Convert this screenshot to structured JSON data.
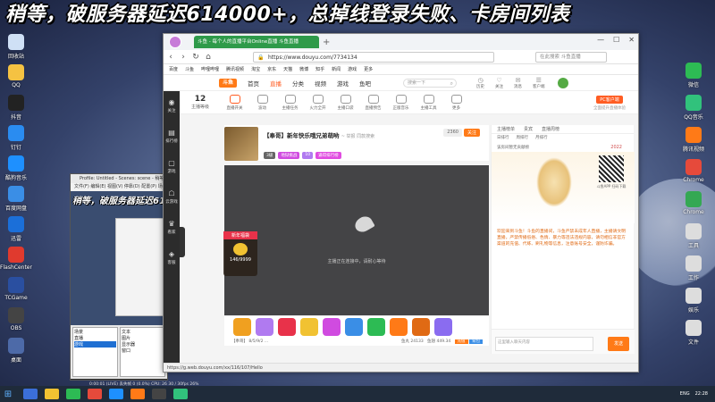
{
  "overlay": {
    "banner": "稍等，破服务器延迟614000+，总掉线登录失败、卡房间列表"
  },
  "desktop_icons": [
    {
      "label": "回收站",
      "color": "#cfe0f5"
    },
    {
      "label": "QQ",
      "color": "#f5c242"
    },
    {
      "label": "抖音",
      "color": "#222222"
    },
    {
      "label": "钉钉",
      "color": "#2a8cf0"
    },
    {
      "label": "酷狗音乐",
      "color": "#1e90ff"
    },
    {
      "label": "百度网盘",
      "color": "#3a8ee6"
    },
    {
      "label": "迅雷",
      "color": "#1b6fd9"
    },
    {
      "label": "FlashCenter",
      "color": "#e03a2e"
    },
    {
      "label": "TCGame",
      "color": "#2a4fa0"
    },
    {
      "label": "OBS",
      "color": "#444444"
    },
    {
      "label": "桌面",
      "color": "#4d6aa8"
    }
  ],
  "desktop_icons_right": [
    {
      "label": "微信",
      "color": "#2dbb54"
    },
    {
      "label": "QQ音乐",
      "color": "#31c27c"
    },
    {
      "label": "腾讯视频",
      "color": "#ff7a17"
    },
    {
      "label": "Chrome",
      "color": "#e64a3b"
    },
    {
      "label": "Chrome",
      "color": "#34a853"
    },
    {
      "label": "工具",
      "color": "#dddddd"
    },
    {
      "label": "工作",
      "color": "#dddddd"
    },
    {
      "label": "娱乐",
      "color": "#dddddd"
    },
    {
      "label": "文件",
      "color": "#dddddd"
    }
  ],
  "obs": {
    "title": "Profile: Untitled - Scenes: scene - 稍等",
    "menu": "文件(F)  编辑(E)  视图(V)  停靠(D)  配置(P)  场景(S)  工具(T)  帮助(H)",
    "mini_banner": "稍等，破服务器延迟61",
    "scenes": [
      "场景",
      "直播",
      "游戏"
    ],
    "sources": [
      "文本",
      "图片",
      "显示器",
      "窗口"
    ],
    "status": "0:00:01 (LIVE)  丢失帧 0 (0.0%)  CPU: 26  30 / 30fps  26%"
  },
  "browser": {
    "tab_title": "斗鱼 - 每个人的直播平台Online直播 斗鱼直播",
    "url": "https://www.douyu.com/7734134",
    "search_placeholder": "在此搜索 斗鱼直播",
    "bookmarks": [
      "百度",
      "斗鱼",
      "哔哩哔哩",
      "腾讯视频",
      "淘宝",
      "京东",
      "天猫",
      "微博",
      "知乎",
      "新闻",
      "游戏",
      "更多"
    ],
    "status_url": "https://g.web.douyu.com/xx/116/107/Hello"
  },
  "douyu": {
    "logo": "斗鱼",
    "nav": [
      "首页",
      "直播",
      "分类",
      "视频",
      "游戏",
      "鱼吧"
    ],
    "nav_active": "直播",
    "search_placeholder": "搜索一下",
    "header_icons": [
      {
        "glyph": "◷",
        "label": "历史"
      },
      {
        "glyph": "♡",
        "label": "关注"
      },
      {
        "glyph": "✉",
        "label": "消息"
      },
      {
        "glyph": "☰",
        "label": "客户端"
      }
    ],
    "sidebar": [
      {
        "glyph": "◉",
        "label": "关注"
      },
      {
        "glyph": "▤",
        "label": "排行榜"
      },
      {
        "glyph": "▢",
        "label": "游戏"
      },
      {
        "glyph": "☖",
        "label": "云游戏"
      },
      {
        "glyph": "♛",
        "label": "看家"
      },
      {
        "glyph": "◈",
        "label": "客服"
      }
    ],
    "gift_strip": {
      "count": "12",
      "count_label": "主播等级",
      "items": [
        "直播开关",
        "波动",
        "主播任务",
        "火力全开",
        "主播口袋",
        "直播预告",
        "正版音乐",
        "主播工具",
        "更多"
      ],
      "pc_tag": "PC客户端",
      "pc_sub": "全面提升直播体验"
    },
    "room": {
      "title": "【奉哥】新年快乐哦兄弟萌哟",
      "title_suffix": "~ 举报  同款搜索",
      "tags": [
        "3级",
        "地狱挑战",
        "10",
        "逼得排行榜"
      ],
      "follow": "关注",
      "follow_count": "2360"
    },
    "player": {
      "hint": "主播正在连接中，请耐心等待",
      "badge_title": "新年福袋",
      "badge_count": "146/9999"
    },
    "bottom": {
      "meta": "【奉哥】 8/5/9/2  ...",
      "balance_left": "鱼丸 24133",
      "balance_right": "鱼翅 449.34",
      "btn_recharge": "充值",
      "btn_gift": "背包"
    },
    "chat": {
      "tabs": [
        "主播榜单",
        "贵宾",
        "直播周榜"
      ],
      "rank": [
        "日排行",
        "周排行",
        "月排行"
      ],
      "notice": "该房间暂无贡献榜",
      "qr_text": "斗鱼APP 扫码下载",
      "badge_year": "2022",
      "message": "欢迎来到斗鱼！斗鱼的直播间，斗鱼严禁未成年人直播，主播请文明直播，严禁传播低俗、色情、暴力等违法违规内容，请勿相信非官方渠道的充值、代练、刷礼物等信息，注意账号安全，谨防诈骗。",
      "input_placeholder": "这里输入聊天内容",
      "send": "发送"
    }
  },
  "taskbar": {
    "start_glyph": "⊞",
    "apps": [
      "#3b6fd9",
      "#f1c232",
      "#2dbb54",
      "#e64a3b",
      "#1e90ff",
      "#ff7a17",
      "#444444",
      "#31c27c"
    ],
    "tray": [
      "ENG",
      "22:28"
    ]
  }
}
